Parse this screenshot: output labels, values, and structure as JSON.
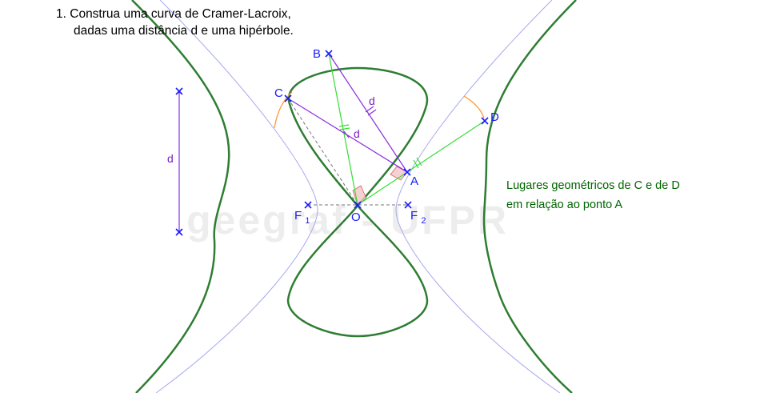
{
  "problem": {
    "number": "1.",
    "line1": "Construa uma curva de Cramer-Lacroix,",
    "line2": "dadas uma distância d e uma hipérbole."
  },
  "watermark": "geegraf - UFPR",
  "points": {
    "A": "A",
    "B": "B",
    "C": "C",
    "D": "D",
    "O": "O",
    "F1": "F",
    "F1_sub": "1",
    "F2": "F",
    "F2_sub": "2"
  },
  "distance_labels": {
    "segment": "d",
    "AB": "d",
    "AC": "d"
  },
  "locus_label": {
    "line1": "Lugares geométricos de C e de D",
    "line2": "em relação ao ponto A"
  },
  "colors": {
    "curve": "#2e7d32",
    "hyperbola": "#a8a8ee",
    "purple": "#8a2be2",
    "green_line": "#33dd33",
    "points": "#1a1aff",
    "arc": "#ff9933"
  }
}
